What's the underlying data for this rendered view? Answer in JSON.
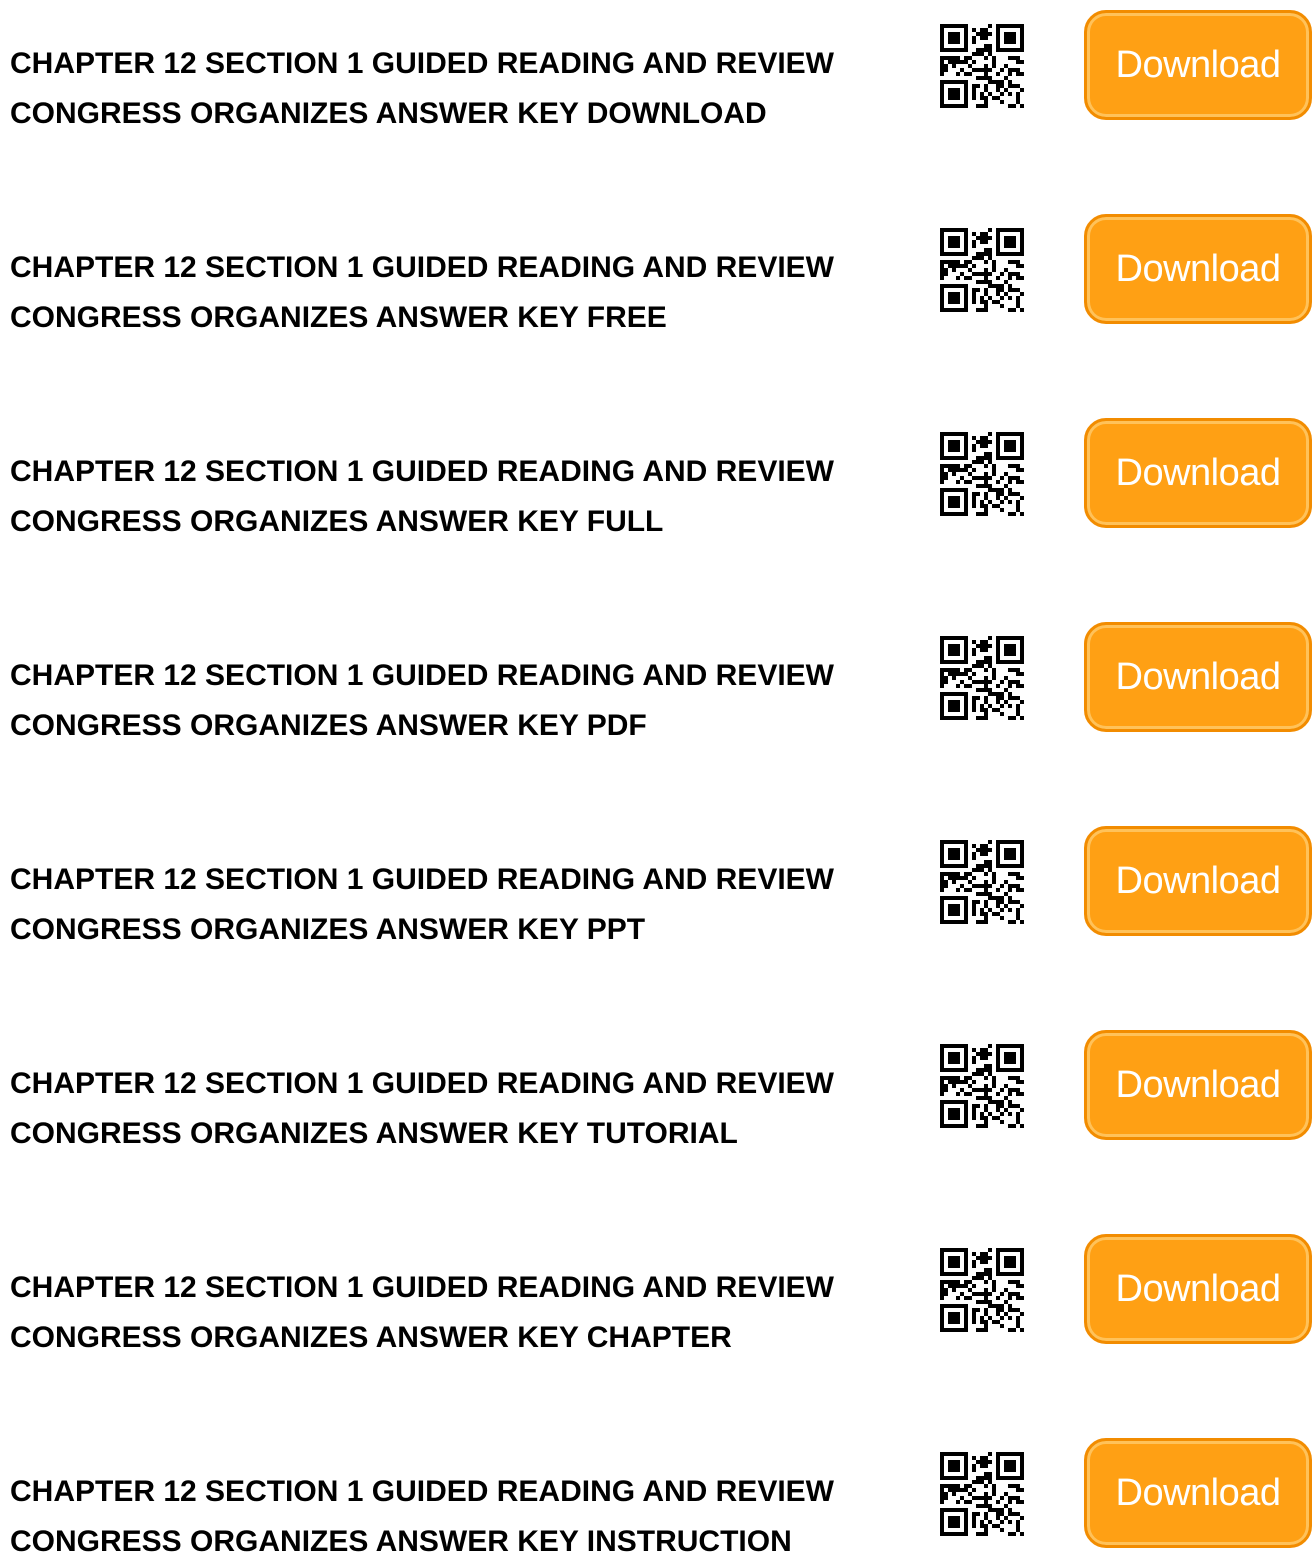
{
  "colors": {
    "button_fill": "#ffa014",
    "button_border": "#f28c00",
    "button_text": "#ffffff",
    "title_text": "#000000"
  },
  "items": [
    {
      "title_line1": "CHAPTER 12 SECTION 1 GUIDED READING AND REVIEW",
      "title_line2": "CONGRESS ORGANIZES ANSWER KEY DOWNLOAD",
      "qr_icon": "qr-code-icon",
      "button_label": "Download"
    },
    {
      "title_line1": "CHAPTER 12 SECTION 1 GUIDED READING AND REVIEW",
      "title_line2": "CONGRESS ORGANIZES ANSWER KEY FREE",
      "qr_icon": "qr-code-icon",
      "button_label": "Download"
    },
    {
      "title_line1": "CHAPTER 12 SECTION 1 GUIDED READING AND REVIEW",
      "title_line2": "CONGRESS ORGANIZES ANSWER KEY FULL",
      "qr_icon": "qr-code-icon",
      "button_label": "Download"
    },
    {
      "title_line1": "CHAPTER 12 SECTION 1 GUIDED READING AND REVIEW",
      "title_line2": "CONGRESS ORGANIZES ANSWER KEY PDF",
      "qr_icon": "qr-code-icon",
      "button_label": "Download"
    },
    {
      "title_line1": "CHAPTER 12 SECTION 1 GUIDED READING AND REVIEW",
      "title_line2": "CONGRESS ORGANIZES ANSWER KEY PPT",
      "qr_icon": "qr-code-icon",
      "button_label": "Download"
    },
    {
      "title_line1": "CHAPTER 12 SECTION 1 GUIDED READING AND REVIEW",
      "title_line2": "CONGRESS ORGANIZES ANSWER KEY TUTORIAL",
      "qr_icon": "qr-code-icon",
      "button_label": "Download"
    },
    {
      "title_line1": "CHAPTER 12 SECTION 1 GUIDED READING AND REVIEW",
      "title_line2": "CONGRESS ORGANIZES ANSWER KEY CHAPTER",
      "qr_icon": "qr-code-icon",
      "button_label": "Download"
    },
    {
      "title_line1": "CHAPTER 12 SECTION 1 GUIDED READING AND REVIEW",
      "title_line2": "CONGRESS ORGANIZES ANSWER KEY INSTRUCTION",
      "qr_icon": "qr-code-icon",
      "button_label": "Download"
    }
  ]
}
